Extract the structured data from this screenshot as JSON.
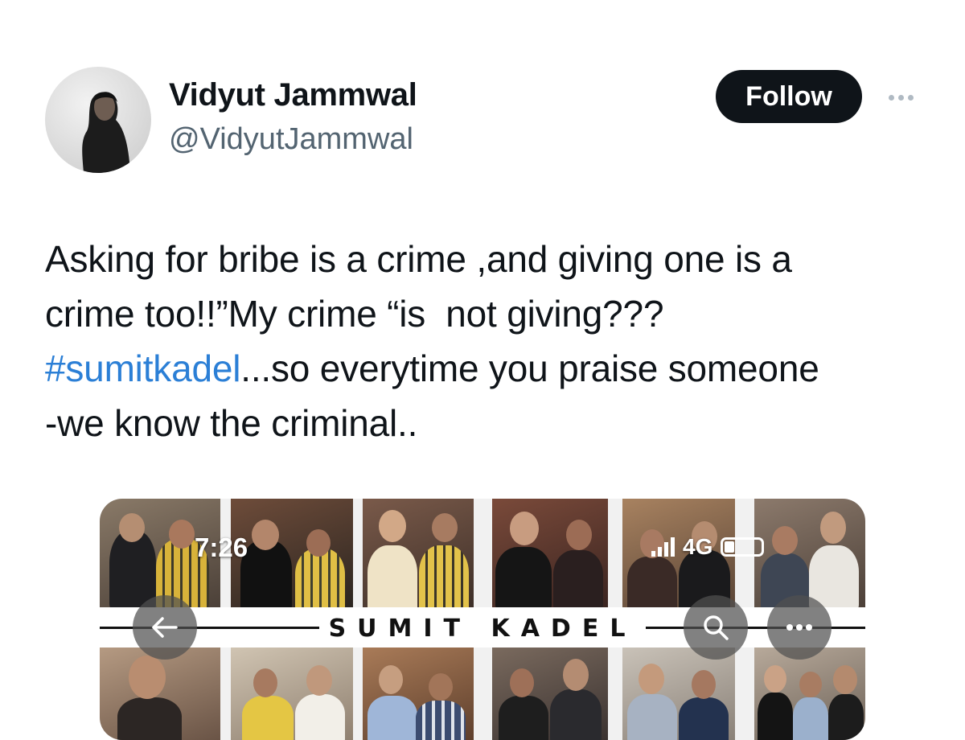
{
  "author": {
    "display_name": "Vidyut Jammwal",
    "handle": "@VidyutJammwal",
    "avatar_icon": "profile-photo"
  },
  "actions": {
    "follow_label": "Follow",
    "more_icon": "more-horizontal-icon"
  },
  "tweet": {
    "line1": "Asking for bribe is a crime ,and giving one is a",
    "line2": "crime too!!”My crime “is  not giving???",
    "hashtag": "#sumitkadel",
    "line3_rest": "...so everytime you praise someone",
    "line4": "-we know the criminal.."
  },
  "media": {
    "status_time": "7:26",
    "network": "4G",
    "banner_title": "SUMIT KADEL",
    "back_icon": "arrow-left-icon",
    "search_icon": "search-icon",
    "menu_icon": "more-horizontal-icon"
  },
  "colors": {
    "text": "#0f1419",
    "secondary": "#536471",
    "hashtag": "#2b7fd6",
    "follow_bg": "#0f1419"
  }
}
